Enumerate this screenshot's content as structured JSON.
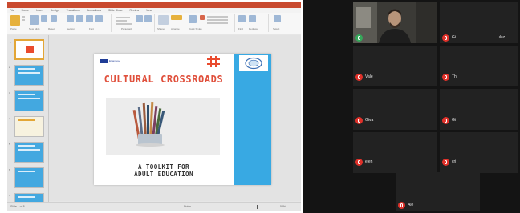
{
  "powerpoint": {
    "tabs": [
      "File",
      "Home",
      "Insert",
      "Design",
      "Transitions",
      "Animations",
      "Slide Show",
      "Review",
      "View"
    ],
    "ribbon_groups": [
      "Paste",
      "New Slide",
      "Reset",
      "Section",
      "Font",
      "Paragraph",
      "Shapes",
      "Arrange",
      "Quick Styles",
      "Find",
      "Replace",
      "Select"
    ],
    "slide": {
      "eu_label": "Erasmus+",
      "title": "CULTURAL CROSSROADS",
      "subtitle_line1": "A TOOLKIT FOR",
      "subtitle_line2": "ADULT EDUCATION"
    },
    "thumbnail_numbers": [
      "1",
      "2",
      "3",
      "4",
      "5",
      "6",
      "7",
      "8"
    ],
    "status": {
      "left": "Slide 1 of 8",
      "notes": "Notes",
      "zoom": "58%"
    },
    "colors": {
      "accent_orange": "#e3a636",
      "title_red": "#e0503c",
      "band_blue": "#38a9e3"
    }
  },
  "meeting": {
    "participants": [
      {
        "name": "",
        "muted": true
      },
      {
        "name": "Gi",
        "muted": true
      },
      {
        "name": "Vale",
        "muted": true
      },
      {
        "name": "Th",
        "muted": true
      },
      {
        "name": "Giva",
        "muted": true
      },
      {
        "name": "Gi",
        "muted": true
      },
      {
        "name": "elen",
        "muted": true
      },
      {
        "name": "cri",
        "muted": true
      },
      {
        "name": "Ale",
        "muted": true
      }
    ],
    "extra_label": "ulaz",
    "mic_icon": "muted-mic-icon",
    "colors": {
      "mic_red": "#e0312a",
      "tile_bg": "#222222"
    }
  }
}
